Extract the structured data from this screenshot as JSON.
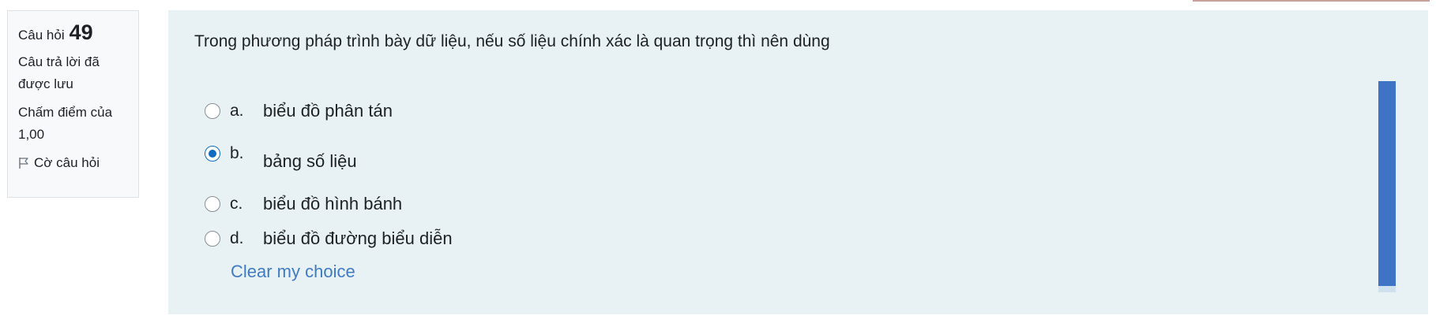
{
  "info": {
    "question_label": "Câu hỏi",
    "question_number": "49",
    "state": "Câu trả lời đã được lưu",
    "grade": "Chấm điểm của 1,00",
    "flag_label": "Cờ câu hỏi",
    "flag_icon": "flag-icon"
  },
  "question": {
    "text": "Trong phương pháp trình bày dữ liệu, nếu số liệu chính xác là quan trọng thì nên dùng",
    "options": [
      {
        "letter": "a.",
        "text": "biểu đồ phân tán",
        "selected": false
      },
      {
        "letter": "b.",
        "text": "bảng số liệu",
        "selected": true
      },
      {
        "letter": "c.",
        "text": "biểu đồ hình bánh",
        "selected": false
      },
      {
        "letter": "d.",
        "text": "biểu đồ đường biểu diễn",
        "selected": false
      }
    ],
    "clear_label": "Clear my choice"
  },
  "colors": {
    "panel_background": "#e8f2f5",
    "link": "#3f7bc2",
    "selected_radio": "#0f6cbf",
    "scrollbar_thumb": "#3f73c5"
  }
}
